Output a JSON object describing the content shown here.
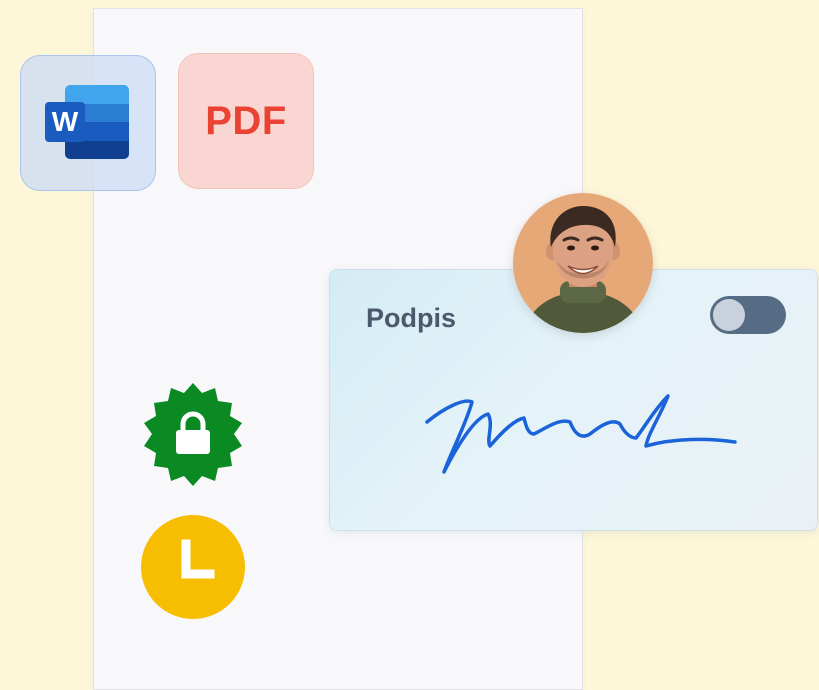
{
  "tiles": {
    "word": {
      "badge_letter": "W",
      "icon": "word-icon"
    },
    "pdf": {
      "label": "PDF",
      "icon": "pdf-icon"
    }
  },
  "signature_card": {
    "label": "Podpis",
    "toggle_state": "on",
    "signature_icon": "handwritten-signature-icon"
  },
  "avatar": {
    "icon": "user-photo"
  },
  "badges": [
    {
      "icon": "lock-icon",
      "color": "#0b8a23"
    },
    {
      "icon": "clock-icon",
      "color": "#f7bd00"
    }
  ],
  "colors": {
    "background": "#fdf6d8",
    "pdf_text": "#ea4233",
    "word_blue": "#1a5bbf",
    "toggle_track": "#566c85",
    "signature_ink": "#1a63d9"
  }
}
